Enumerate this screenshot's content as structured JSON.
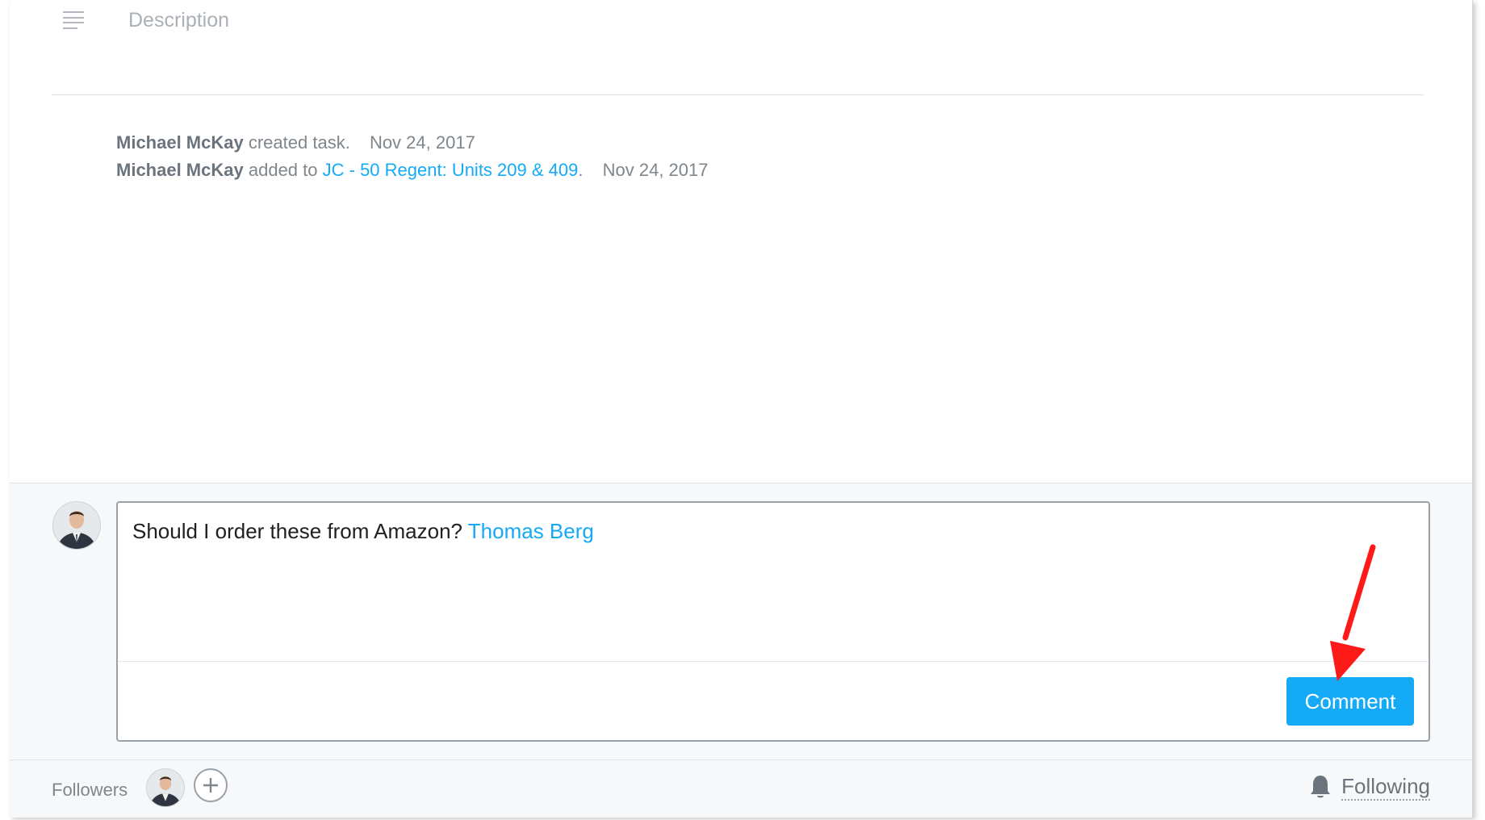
{
  "description": {
    "icon": "text-lines-icon",
    "placeholder": "Description"
  },
  "activity": [
    {
      "actor": "Michael McKay",
      "action": "created task.",
      "date": "Nov 24, 2017"
    },
    {
      "actor": "Michael McKay",
      "action": "added to",
      "project_link": "JC - 50 Regent: Units 209 & 409",
      "suffix": ".",
      "date": "Nov 24, 2017"
    }
  ],
  "composer": {
    "text": "Should I order these from Amazon?",
    "mention": "Thomas Berg",
    "button_label": "Comment"
  },
  "footer": {
    "followers_label": "Followers",
    "add_icon": "plus-icon",
    "following_icon": "bell-icon",
    "following_label": "Following"
  },
  "colors": {
    "accent": "#14aaf5",
    "annotation_arrow": "#ff1a1a"
  }
}
